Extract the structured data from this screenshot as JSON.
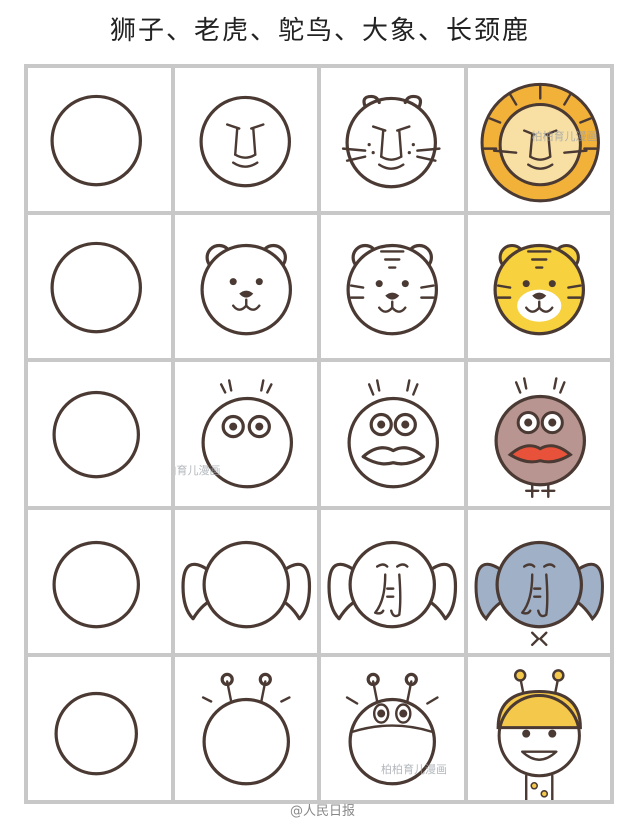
{
  "title": "狮子、老虎、鸵鸟、大象、长颈鹿",
  "grid": {
    "columns": 4,
    "rows": 5,
    "row_labels": [
      "lion",
      "tiger",
      "ostrich",
      "elephant",
      "giraffe"
    ]
  },
  "watermark": "柏柏育儿漫画",
  "credit": "@人民日报",
  "colors": {
    "line": "#4a3a33",
    "grid": "#c8c8c8",
    "lion_mane": "#f2b23a",
    "lion_face": "#f8e0a5",
    "tiger": "#f7d23e",
    "ostrich": "#b89591",
    "ostrich_beak": "#e8513a",
    "elephant": "#9fb0c7",
    "giraffe": "#f4c84a"
  }
}
